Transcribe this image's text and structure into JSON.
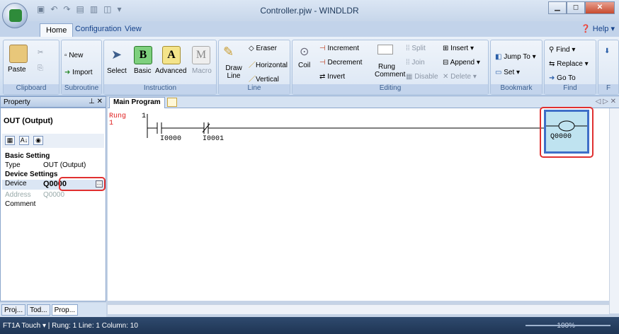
{
  "window": {
    "title": "Controller.pjw - WINDLDR",
    "min": "▁",
    "max": "◻",
    "close": "✕"
  },
  "tabs": [
    {
      "label": "Home"
    },
    {
      "label": "Configuration"
    },
    {
      "label": "View"
    }
  ],
  "help_label": "Help",
  "ribbon": {
    "clipboard": {
      "label": "Clipboard",
      "paste": "Paste"
    },
    "subroutine": {
      "label": "Subroutine",
      "new": "New",
      "import": "Import"
    },
    "instruction": {
      "label": "Instruction",
      "select": "Select",
      "basic": "Basic",
      "advanced": "Advanced",
      "macro": "Macro"
    },
    "line": {
      "label": "Line",
      "draw_line": "Draw Line",
      "eraser": "Eraser",
      "horizontal": "Horizontal",
      "vertical": "Vertical"
    },
    "editing": {
      "label": "Editing",
      "coil": "Coil",
      "increment": "Increment",
      "decrement": "Decrement",
      "invert": "Invert",
      "rung_comment": "Rung Comment",
      "split": "Split",
      "join": "Join",
      "disable": "Disable",
      "insert": "Insert",
      "append": "Append",
      "delete": "Delete"
    },
    "bookmark": {
      "label": "Bookmark",
      "jump_to": "Jump To",
      "set": "Set"
    },
    "find": {
      "label": "Find",
      "find": "Find",
      "replace": "Replace",
      "go_to": "Go To"
    }
  },
  "property_panel": {
    "header": "Property",
    "title": "OUT (Output)",
    "basic_setting": "Basic Setting",
    "type_key": "Type",
    "type_value": "OUT (Output)",
    "device_settings": "Device Settings",
    "device_key": "Device",
    "device_value": "Q0000",
    "address_key": "Address",
    "address_value": "Q0000",
    "comment_key": "Comment"
  },
  "bottom_tabs": [
    {
      "label": "Proj..."
    },
    {
      "label": "Tod..."
    },
    {
      "label": "Prop..."
    }
  ],
  "document": {
    "tab": "Main Program",
    "nav": "◁ ▷ ✕"
  },
  "ladder": {
    "rung_label": "Rung",
    "rung_number": "1",
    "rung_side": "1",
    "contacts": [
      {
        "label": "I0000"
      },
      {
        "label": "I0001"
      }
    ],
    "coil_label": "Q0000"
  },
  "status": {
    "text": "FT1A Touch ▾ | Rung: 1  Line: 1  Column: 10",
    "zoom": "100%"
  }
}
